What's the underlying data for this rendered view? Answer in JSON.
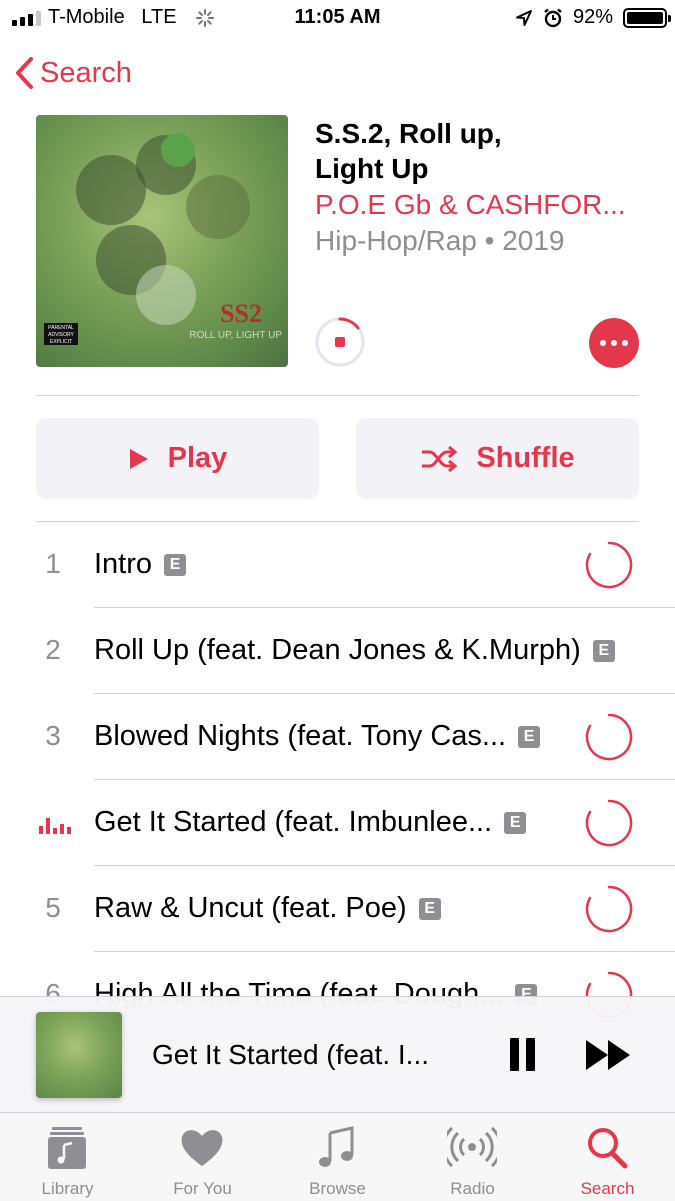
{
  "status_bar": {
    "carrier": "T-Mobile",
    "network": "LTE",
    "time": "11:05 AM",
    "battery": "92%",
    "icons": [
      "signal-icon",
      "loading-icon",
      "location-icon",
      "alarm-icon",
      "battery-icon"
    ]
  },
  "nav": {
    "back_label": "Search"
  },
  "album": {
    "title_line1": "S.S.2, Roll up,",
    "title_line2": "Light Up",
    "artist": "P.O.E Gb & CASHFOR...",
    "meta": "Hip-Hop/Rap • 2019",
    "cover_text": "SS2",
    "cover_subtext": "ROLL UP, LIGHT UP"
  },
  "actions": {
    "play_label": "Play",
    "shuffle_label": "Shuffle"
  },
  "tracks": [
    {
      "number": "1",
      "title": "Intro",
      "explicit": "E",
      "downloading": true
    },
    {
      "number": "2",
      "title": "Roll Up (feat. Dean Jones & K.Murph)",
      "explicit": "E",
      "downloading": false
    },
    {
      "number": "3",
      "title": "Blowed Nights (feat. Tony Cas...",
      "explicit": "E",
      "downloading": true
    },
    {
      "number": "",
      "title": "Get It Started (feat. Imbunlee...",
      "explicit": "E",
      "downloading": true,
      "now_playing": true
    },
    {
      "number": "5",
      "title": "Raw & Uncut (feat. Poe)",
      "explicit": "E",
      "downloading": true
    },
    {
      "number": "6",
      "title": "High All the Time (feat. Dough...",
      "explicit": "E",
      "downloading": true
    }
  ],
  "mini_player": {
    "title": "Get It Started (feat. I..."
  },
  "tabs": [
    {
      "label": "Library",
      "icon": "library-icon"
    },
    {
      "label": "For You",
      "icon": "heart-icon"
    },
    {
      "label": "Browse",
      "icon": "music-note-icon"
    },
    {
      "label": "Radio",
      "icon": "radio-icon"
    },
    {
      "label": "Search",
      "icon": "search-icon",
      "active": true
    }
  ],
  "colors": {
    "accent": "#e5374c",
    "secondary_text": "#8e8e93",
    "button_bg": "#f2f2f7"
  }
}
